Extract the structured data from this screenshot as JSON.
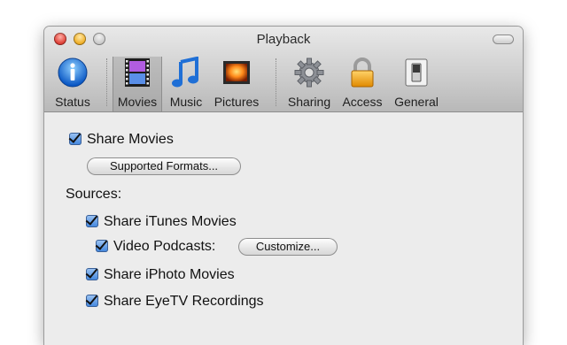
{
  "window": {
    "title": "Playback"
  },
  "toolbar": {
    "items": [
      {
        "label": "Status",
        "icon": "info-icon"
      },
      {
        "label": "Movies",
        "icon": "film-icon",
        "selected": true
      },
      {
        "label": "Music",
        "icon": "music-note-icon"
      },
      {
        "label": "Pictures",
        "icon": "picture-icon"
      },
      {
        "label": "Sharing",
        "icon": "gear-icon"
      },
      {
        "label": "Access",
        "icon": "lock-icon"
      },
      {
        "label": "General",
        "icon": "switch-icon"
      }
    ]
  },
  "content": {
    "share_movies": "Share Movies",
    "supported_formats": "Supported Formats...",
    "sources_label": "Sources:",
    "share_itunes_movies": "Share iTunes Movies",
    "video_podcasts": "Video Podcasts:",
    "customize": "Customize...",
    "share_iphoto_movies": "Share iPhoto Movies",
    "share_eyetv": "Share EyeTV Recordings"
  },
  "colors": {
    "accent": "#3f84dd",
    "toolbar_bg": "#cfcfcf",
    "panel_bg": "#ececec"
  }
}
